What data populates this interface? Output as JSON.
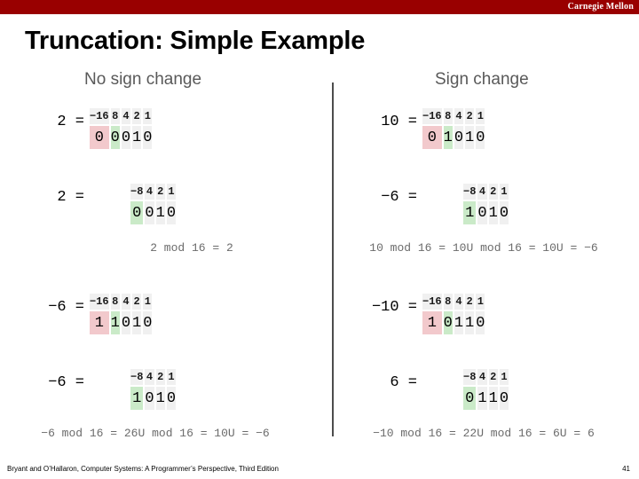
{
  "banner": {
    "institution": "Carnegie Mellon",
    "color": "#990000"
  },
  "slide": {
    "title": "Truncation: Simple Example",
    "headings": {
      "left": "No sign change",
      "right": "Sign change"
    }
  },
  "colors": {
    "cell_bg": "#f0f0f0",
    "highlight_red": "#f2c9cc",
    "highlight_green": "#caeac8",
    "heading_text": "#595959",
    "mod_text": "#6b6b6b",
    "divider": "#4d4d4d"
  },
  "examples": [
    {
      "id": "left-top",
      "wide": {
        "label": "2 =",
        "weights": [
          "−16",
          "8",
          "4",
          "2",
          "1"
        ],
        "bits": [
          "0",
          "0",
          "0",
          "1",
          "0"
        ],
        "highlights": [
          "red",
          "green",
          "none",
          "none",
          "none"
        ]
      },
      "narrow": {
        "label": "2 =",
        "weights": [
          "−8",
          "4",
          "2",
          "1"
        ],
        "bits": [
          "0",
          "0",
          "1",
          "0"
        ],
        "highlights": [
          "green",
          "none",
          "none",
          "none"
        ]
      },
      "mod_line": "2 mod 16 = 2"
    },
    {
      "id": "right-top",
      "wide": {
        "label": "10 =",
        "weights": [
          "−16",
          "8",
          "4",
          "2",
          "1"
        ],
        "bits": [
          "0",
          "1",
          "0",
          "1",
          "0"
        ],
        "highlights": [
          "red",
          "green",
          "none",
          "none",
          "none"
        ]
      },
      "narrow": {
        "label": "−6 =",
        "weights": [
          "−8",
          "4",
          "2",
          "1"
        ],
        "bits": [
          "1",
          "0",
          "1",
          "0"
        ],
        "highlights": [
          "green",
          "none",
          "none",
          "none"
        ]
      },
      "mod_line": "10 mod 16 = 10U mod 16 = 10U = −6"
    },
    {
      "id": "left-bottom",
      "wide": {
        "label": "−6 =",
        "weights": [
          "−16",
          "8",
          "4",
          "2",
          "1"
        ],
        "bits": [
          "1",
          "1",
          "0",
          "1",
          "0"
        ],
        "highlights": [
          "red",
          "green",
          "none",
          "none",
          "none"
        ]
      },
      "narrow": {
        "label": "−6 =",
        "weights": [
          "−8",
          "4",
          "2",
          "1"
        ],
        "bits": [
          "1",
          "0",
          "1",
          "0"
        ],
        "highlights": [
          "green",
          "none",
          "none",
          "none"
        ]
      },
      "mod_line": "−6 mod 16 = 26U mod 16 = 10U = −6"
    },
    {
      "id": "right-bottom",
      "wide": {
        "label": "−10 =",
        "weights": [
          "−16",
          "8",
          "4",
          "2",
          "1"
        ],
        "bits": [
          "1",
          "0",
          "1",
          "1",
          "0"
        ],
        "highlights": [
          "red",
          "green",
          "none",
          "none",
          "none"
        ]
      },
      "narrow": {
        "label": "6 =",
        "weights": [
          "−8",
          "4",
          "2",
          "1"
        ],
        "bits": [
          "0",
          "1",
          "1",
          "0"
        ],
        "highlights": [
          "green",
          "none",
          "none",
          "none"
        ]
      },
      "mod_line": "−10 mod 16 = 22U mod 16 = 6U = 6"
    }
  ],
  "footer": {
    "citation": "Bryant and O’Hallaron, Computer Systems: A Programmer’s Perspective, Third Edition",
    "page": "41"
  }
}
